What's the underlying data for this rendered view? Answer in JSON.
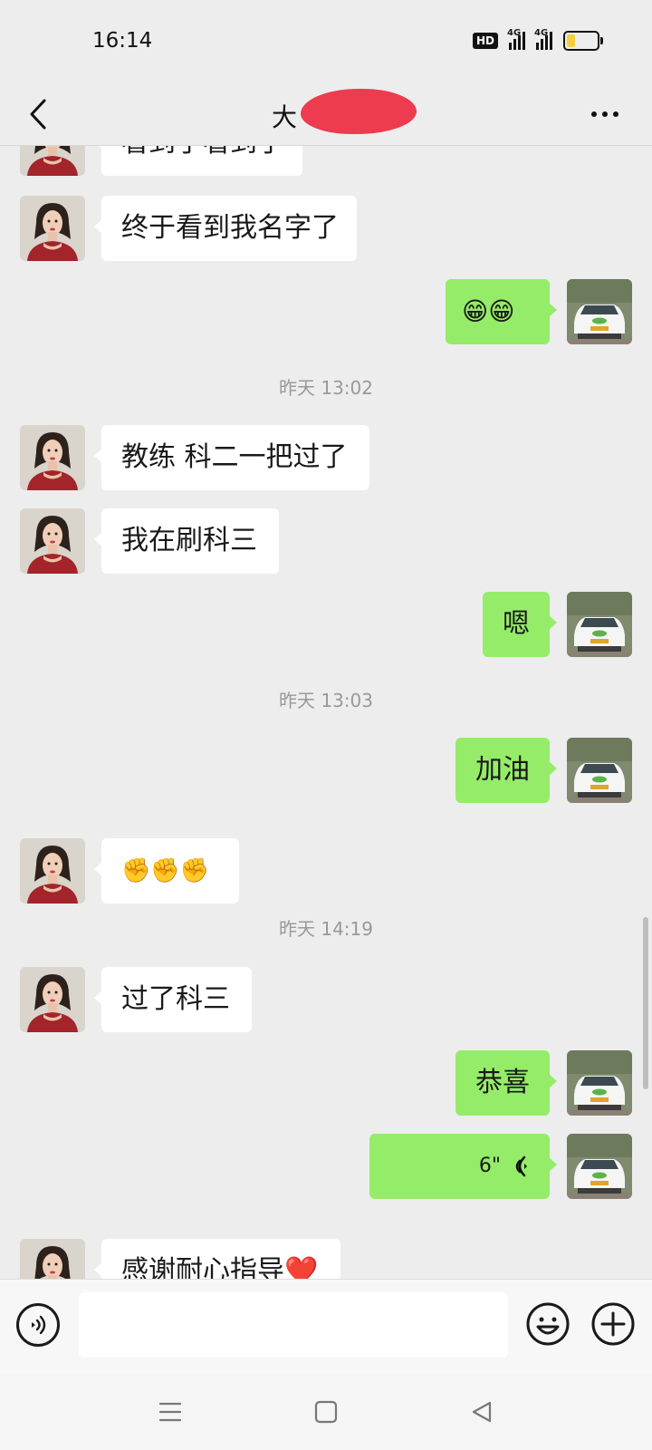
{
  "status_bar": {
    "time": "16:14",
    "hd_label": "HD",
    "network_1": "4G",
    "network_2": "4G",
    "icons": [
      "hd-voice-icon",
      "signal-4g-icon",
      "signal-4g-icon",
      "battery-icon"
    ]
  },
  "header": {
    "title_visible": "大",
    "icons": [
      "back-arrow-icon",
      "more-dots-icon"
    ]
  },
  "chat": {
    "messages": [
      {
        "side": "left",
        "type": "text",
        "text": "看到了看到了"
      },
      {
        "side": "left",
        "type": "text",
        "text": "终于看到我名字了"
      },
      {
        "side": "right",
        "type": "emoji",
        "text": "😁😁"
      },
      {
        "type": "time",
        "text": "昨天 13:02"
      },
      {
        "side": "left",
        "type": "text",
        "text": "教练 科二一把过了"
      },
      {
        "side": "left",
        "type": "text",
        "text": "我在刷科三"
      },
      {
        "side": "right",
        "type": "text",
        "text": "嗯"
      },
      {
        "type": "time",
        "text": "昨天 13:03"
      },
      {
        "side": "right",
        "type": "text",
        "text": "加油"
      },
      {
        "side": "left",
        "type": "emoji",
        "text": "✊✊✊"
      },
      {
        "type": "time",
        "text": "昨天 14:19"
      },
      {
        "side": "left",
        "type": "text",
        "text": "过了科三"
      },
      {
        "side": "right",
        "type": "text",
        "text": "恭喜"
      },
      {
        "side": "right",
        "type": "voice",
        "text": "6\""
      },
      {
        "side": "left",
        "type": "text",
        "text": "感谢耐心指导❤️"
      }
    ]
  },
  "input_bar": {
    "message_input_value": "",
    "icons": [
      "voice-mode-icon",
      "emoji-icon",
      "plus-icon"
    ]
  },
  "system_nav": {
    "icons": [
      "menu-icon",
      "home-icon",
      "back-triangle-icon"
    ]
  },
  "colors": {
    "background": "#ededed",
    "sent_bubble": "#95ec69",
    "received_bubble": "#ffffff",
    "redaction": "#ed3b4f"
  }
}
